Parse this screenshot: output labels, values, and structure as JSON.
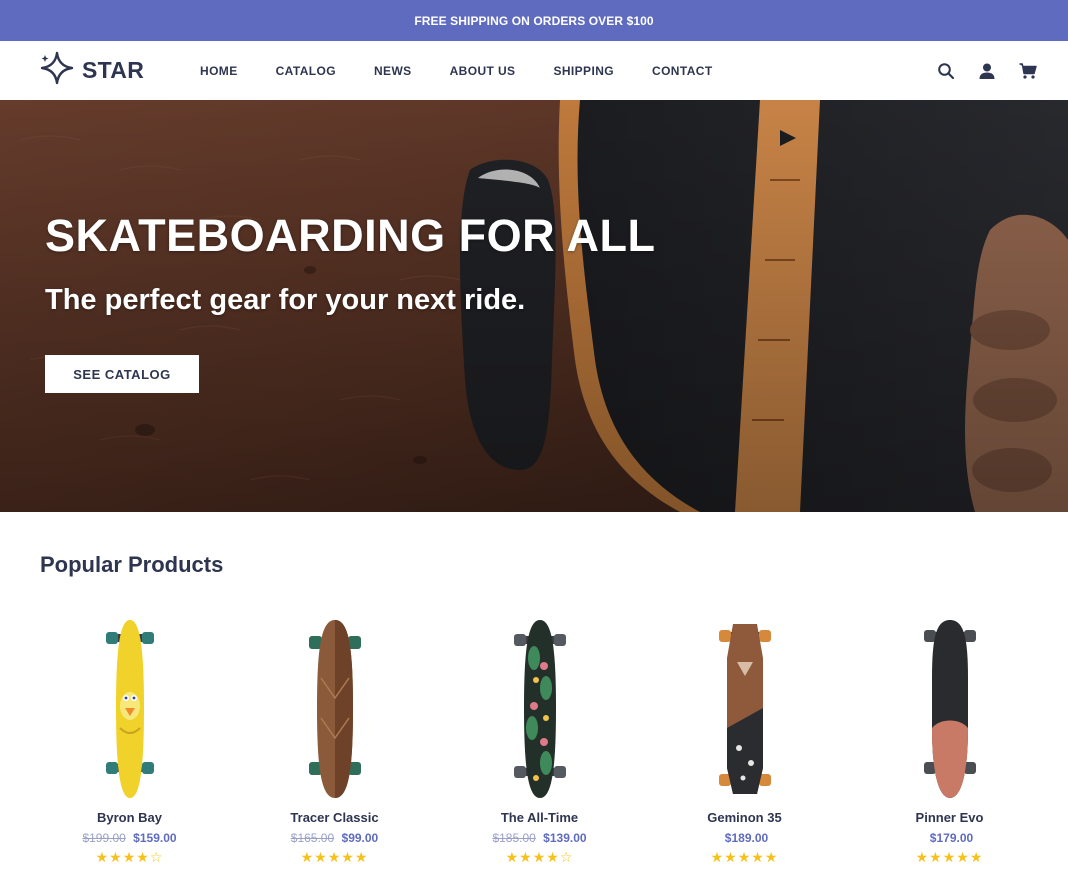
{
  "announcement": "FREE SHIPPING ON ORDERS OVER $100",
  "logo": {
    "text": "STAR",
    "icon": "four-point-star-icon",
    "color": "#2e3550"
  },
  "nav": [
    "HOME",
    "CATALOG",
    "NEWS",
    "ABOUT US",
    "SHIPPING",
    "CONTACT"
  ],
  "header_icons": [
    "search-icon",
    "account-icon",
    "cart-icon"
  ],
  "hero": {
    "title": "SKATEBOARDING FOR ALL",
    "subtitle": "The perfect gear for your next ride.",
    "button": "SEE CATALOG"
  },
  "popular": {
    "title": "Popular Products",
    "products": [
      {
        "name": "Byron Bay",
        "old_price": "$199.00",
        "price": "$159.00",
        "stars": "★★★★☆"
      },
      {
        "name": "Tracer Classic",
        "old_price": "$165.00",
        "price": "$99.00",
        "stars": "★★★★★"
      },
      {
        "name": "The All-Time",
        "old_price": "$185.00",
        "price": "$139.00",
        "stars": "★★★★☆"
      },
      {
        "name": "Geminon 35",
        "old_price": "",
        "price": "$189.00",
        "stars": "★★★★★"
      },
      {
        "name": "Pinner Evo",
        "old_price": "",
        "price": "$179.00",
        "stars": "★★★★★"
      }
    ]
  },
  "colors": {
    "accent": "#5f6bbf",
    "brand": "#2e3550",
    "star": "#f6c11b"
  }
}
